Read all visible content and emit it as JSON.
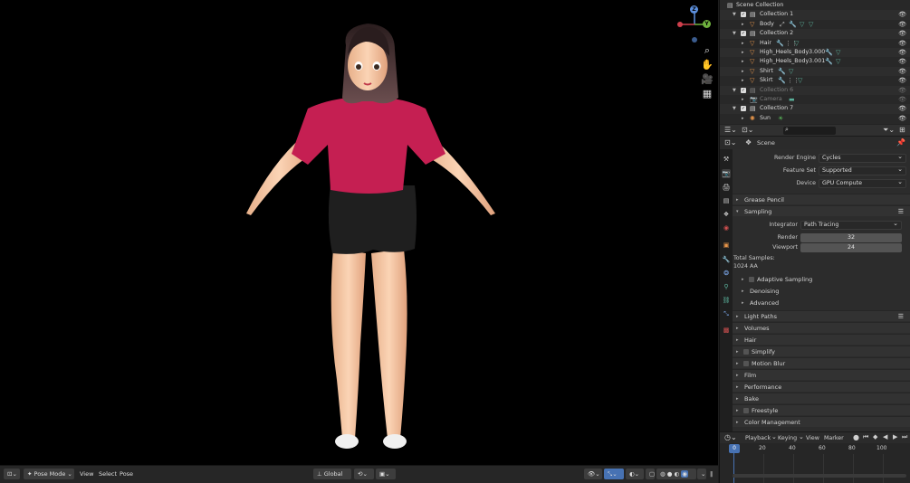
{
  "viewport": {
    "gizmo": {
      "z": "Z",
      "y": "Y",
      "x": "X"
    }
  },
  "header": {
    "mode": "Pose Mode",
    "menus": [
      "View",
      "Select",
      "Pose"
    ],
    "orientation": "Global"
  },
  "outliner": {
    "root": "Scene Collection",
    "rows": [
      {
        "label": "Collection 1"
      },
      {
        "label": "Body"
      },
      {
        "label": "Collection 2"
      },
      {
        "label": "Hair"
      },
      {
        "label": "High_Heels_Body3.000"
      },
      {
        "label": "High_Heels_Body3.001"
      },
      {
        "label": "Shirt"
      },
      {
        "label": "Skirt"
      },
      {
        "label": "Collection 6"
      },
      {
        "label": "Camera"
      },
      {
        "label": "Collection 7"
      },
      {
        "label": "Sun"
      }
    ]
  },
  "properties": {
    "context": "Scene",
    "render_engine_label": "Render Engine",
    "render_engine": "Cycles",
    "feature_set_label": "Feature Set",
    "feature_set": "Supported",
    "device_label": "Device",
    "device": "GPU Compute",
    "integrator_label": "Integrator",
    "integrator": "Path Tracing",
    "render_label": "Render",
    "render_samples": "32",
    "viewport_label": "Viewport",
    "viewport_samples": "24",
    "total_samples_label": "Total Samples:",
    "total_samples": "1024 AA",
    "panels": {
      "grease_pencil": "Grease Pencil",
      "sampling": "Sampling",
      "adaptive_sampling": "Adaptive Sampling",
      "denoising": "Denoising",
      "advanced": "Advanced",
      "light_paths": "Light Paths",
      "volumes": "Volumes",
      "hair": "Hair",
      "simplify": "Simplify",
      "motion_blur": "Motion Blur",
      "film": "Film",
      "performance": "Performance",
      "bake": "Bake",
      "freestyle": "Freestyle",
      "color_management": "Color Management"
    }
  },
  "timeline": {
    "menus": [
      "Playback",
      "Keying",
      "View",
      "Marker"
    ],
    "current_frame": "0",
    "ticks": [
      "20",
      "40",
      "60",
      "80",
      "100"
    ]
  },
  "colors": {
    "accent": "#4772b3",
    "mesh_icon": "#e8964a",
    "modifier_icon": "#7aa6e8",
    "material_icon": "#5ab09a",
    "camera_icon": "#c0894a",
    "light_icon": "#5cc05c"
  }
}
